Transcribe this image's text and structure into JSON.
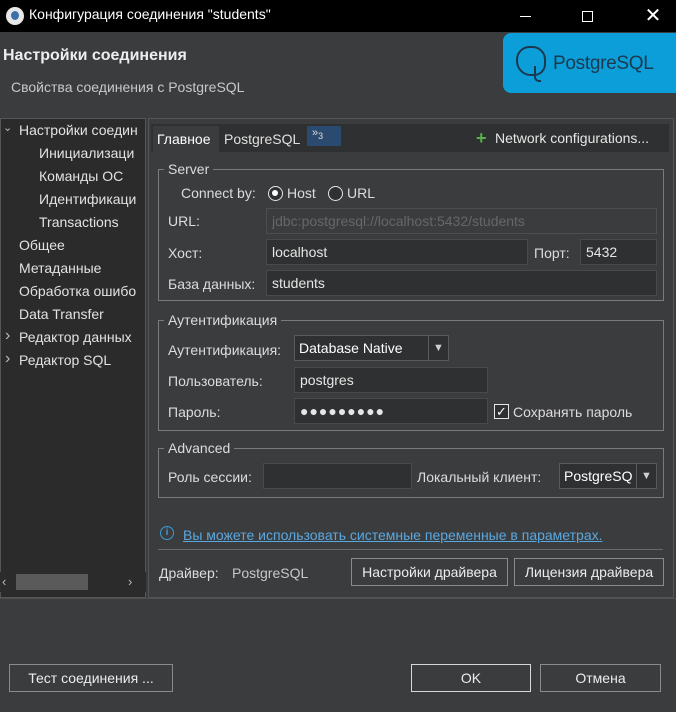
{
  "window": {
    "title": "Конфигурация соединения \"students\"",
    "min_glyph": "",
    "max_glyph": "",
    "close_glyph": "✕"
  },
  "header": {
    "title": "Настройки соединения",
    "subtitle": "Свойства соединения с PostgreSQL",
    "logo_text": "PostgreSQL"
  },
  "tree": {
    "items": [
      {
        "label": "Настройки соедин",
        "expanded": true
      },
      {
        "label": "Инициализаци"
      },
      {
        "label": "Команды ОС"
      },
      {
        "label": "Идентификаци"
      },
      {
        "label": "Transactions"
      },
      {
        "label": "Общее"
      },
      {
        "label": "Метаданные"
      },
      {
        "label": "Обработка ошибо"
      },
      {
        "label": "Data Transfer"
      },
      {
        "label": "Редактор данных"
      },
      {
        "label": "Редактор SQL"
      }
    ],
    "arrow_expanded": "⌄",
    "arrow_collapsed": "›",
    "scroll_left": "‹",
    "scroll_right": "›"
  },
  "tabs": {
    "main": "Главное",
    "postgresql": "PostgreSQL",
    "more": "»",
    "more_count": "3",
    "network_plus": "+",
    "network": "Network configurations..."
  },
  "server": {
    "title": "Server",
    "connect_by_label": "Connect by:",
    "host_option": "Host",
    "url_option": "URL",
    "url_label": "URL:",
    "url_value": "jdbc:postgresql://localhost:5432/students",
    "host_label": "Хост:",
    "host_value": "localhost",
    "port_label": "Порт:",
    "port_value": "5432",
    "db_label": "База данных:",
    "db_value": "students"
  },
  "auth": {
    "title": "Аутентификация",
    "auth_label": "Аутентификация:",
    "auth_value": "Database Native",
    "user_label": "Пользователь:",
    "user_value": "postgres",
    "password_label": "Пароль:",
    "password_value": "●●●●●●●●●",
    "save_password_label": "Сохранять пароль",
    "save_password_checked": true,
    "check_glyph": "✓"
  },
  "advanced": {
    "title": "Advanced",
    "role_label": "Роль сессии:",
    "role_value": "",
    "client_label": "Локальный клиент:",
    "client_value": "PostgreSQ"
  },
  "info": {
    "icon": "i",
    "link": "Вы можете использовать системные переменные в параметрах."
  },
  "driver": {
    "label": "Драйвер:",
    "value": "PostgreSQL",
    "settings_button": "Настройки драйвера",
    "license_button": "Лицензия драйвера"
  },
  "footer": {
    "test_button": "Тест соединения ...",
    "ok_button": "OK",
    "cancel_button": "Отмена"
  },
  "colors": {
    "accent_link": "#5aa8e0",
    "logo_bg": "#0b9ed8",
    "plus_green": "#59b14c"
  }
}
